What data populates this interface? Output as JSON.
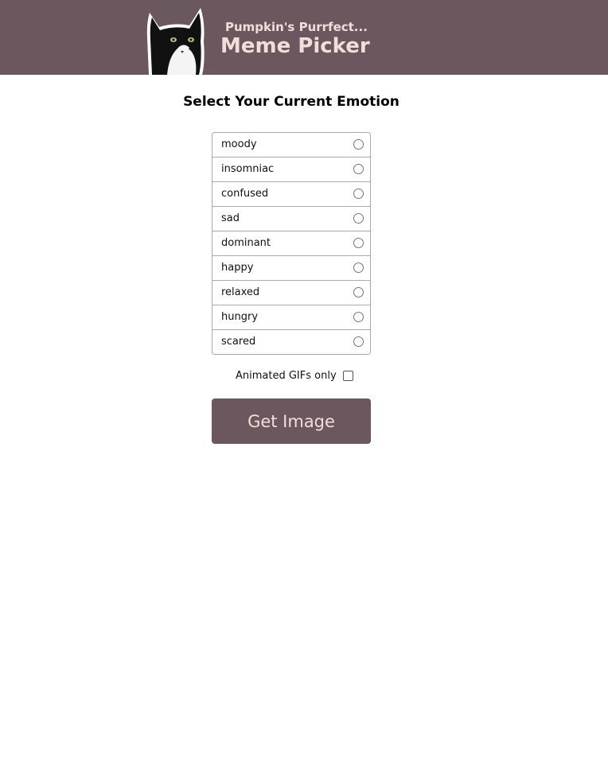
{
  "header": {
    "subtitle": "Pumpkin's Purrfect...",
    "title": "Meme Picker",
    "background_color": "#6b585e",
    "text_color": "#f1dedb",
    "logo_icon": "tuxedo-cat-logo"
  },
  "main": {
    "heading": "Select Your Current Emotion",
    "emotions": [
      {
        "label": "moody",
        "selected": false
      },
      {
        "label": "insomniac",
        "selected": false
      },
      {
        "label": "confused",
        "selected": false
      },
      {
        "label": "sad",
        "selected": false
      },
      {
        "label": "dominant",
        "selected": false
      },
      {
        "label": "happy",
        "selected": false
      },
      {
        "label": "relaxed",
        "selected": false
      },
      {
        "label": "hungry",
        "selected": false
      },
      {
        "label": "scared",
        "selected": false
      }
    ],
    "gif_option": {
      "label": "Animated GIFs only",
      "checked": false
    },
    "button_label": "Get Image"
  }
}
